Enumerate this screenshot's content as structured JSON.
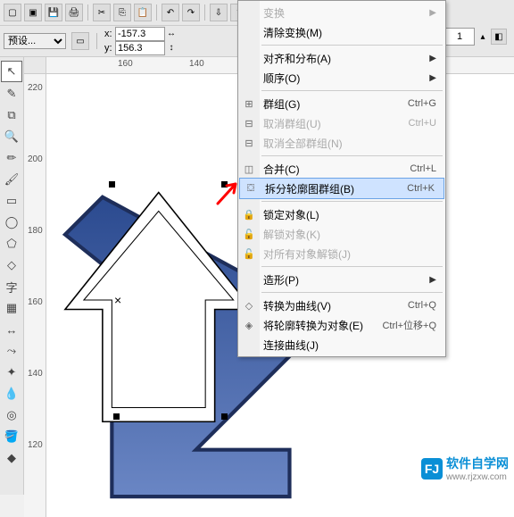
{
  "toolbar": {
    "preset_label": "预设...",
    "x_label": "x:",
    "y_label": "y:",
    "x_value": "-157.3",
    "y_value": "156.3"
  },
  "ruler_h": [
    "160",
    "140"
  ],
  "ruler_v": [
    "220",
    "200",
    "180",
    "160",
    "140",
    "120"
  ],
  "right_panel": {
    "value": "1"
  },
  "menu": {
    "items": [
      {
        "label": "变换",
        "disabled": true,
        "shortcut": "",
        "submenu": true,
        "icon": "",
        "sep_after": false
      },
      {
        "label": "清除变换(M)",
        "disabled": false,
        "shortcut": "",
        "submenu": false,
        "icon": "",
        "sep_after": true
      },
      {
        "label": "对齐和分布(A)",
        "disabled": false,
        "shortcut": "",
        "submenu": true,
        "icon": "",
        "sep_after": false
      },
      {
        "label": "顺序(O)",
        "disabled": false,
        "shortcut": "",
        "submenu": true,
        "icon": "",
        "sep_after": true
      },
      {
        "label": "群组(G)",
        "disabled": false,
        "shortcut": "Ctrl+G",
        "submenu": false,
        "icon": "⊞",
        "sep_after": false
      },
      {
        "label": "取消群组(U)",
        "disabled": true,
        "shortcut": "Ctrl+U",
        "submenu": false,
        "icon": "⊟",
        "sep_after": false
      },
      {
        "label": "取消全部群组(N)",
        "disabled": true,
        "shortcut": "",
        "submenu": false,
        "icon": "⊟",
        "sep_after": true
      },
      {
        "label": "合并(C)",
        "disabled": false,
        "shortcut": "Ctrl+L",
        "submenu": false,
        "icon": "◫",
        "sep_after": false
      },
      {
        "label": "拆分轮廓图群组(B)",
        "disabled": false,
        "shortcut": "Ctrl+K",
        "submenu": false,
        "icon": "⛋",
        "highlight": true,
        "sep_after": true
      },
      {
        "label": "锁定对象(L)",
        "disabled": false,
        "shortcut": "",
        "submenu": false,
        "icon": "🔒",
        "sep_after": false
      },
      {
        "label": "解锁对象(K)",
        "disabled": true,
        "shortcut": "",
        "submenu": false,
        "icon": "🔓",
        "sep_after": false
      },
      {
        "label": "对所有对象解锁(J)",
        "disabled": true,
        "shortcut": "",
        "submenu": false,
        "icon": "🔓",
        "sep_after": true
      },
      {
        "label": "造形(P)",
        "disabled": false,
        "shortcut": "",
        "submenu": true,
        "icon": "",
        "sep_after": true
      },
      {
        "label": "转换为曲线(V)",
        "disabled": false,
        "shortcut": "Ctrl+Q",
        "submenu": false,
        "icon": "◇",
        "sep_after": false
      },
      {
        "label": "将轮廓转换为对象(E)",
        "disabled": false,
        "shortcut": "Ctrl+位移+Q",
        "submenu": false,
        "icon": "◈",
        "sep_after": false
      },
      {
        "label": "连接曲线(J)",
        "disabled": false,
        "shortcut": "",
        "submenu": false,
        "icon": "",
        "sep_after": false
      }
    ]
  },
  "watermark": {
    "logo_text": "FJ",
    "cn": "软件自学网",
    "url": "www.rjzxw.com"
  }
}
